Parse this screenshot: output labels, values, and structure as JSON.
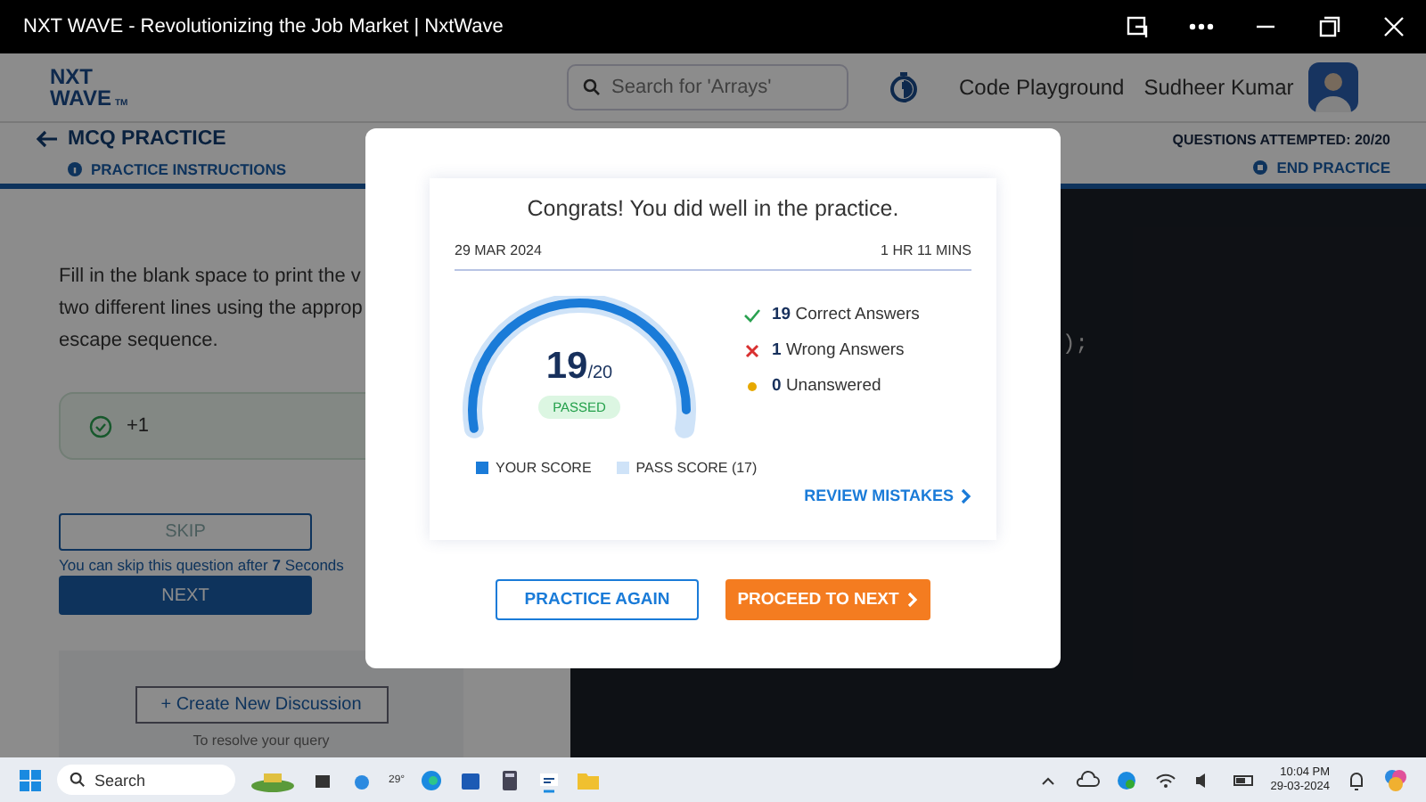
{
  "window": {
    "title": "NXT WAVE - Revolutionizing the Job Market | NxtWave"
  },
  "header": {
    "logo": {
      "line1": "NXT",
      "line2": "WAVE",
      "mark": "TM"
    },
    "search": {
      "placeholder": "Search for 'Arrays'"
    },
    "link": "Code Playground",
    "user": "Sudheer Kumar"
  },
  "subheader": {
    "title": "MCQ PRACTICE",
    "instructions": "PRACTICE INSTRUCTIONS",
    "attempted": "QUESTIONS ATTEMPTED: 20/20",
    "end": "END PRACTICE"
  },
  "question": {
    "lines": [
      "Fill in the blank space to print the v",
      "two different lines using the approp",
      "escape sequence."
    ],
    "result": {
      "score": "+1",
      "correct": true
    },
    "skip": {
      "label": "SKIP",
      "disabled": true
    },
    "skip_note": "You can skip this question after **7** Seconds",
    "next": "NEXT",
    "discussion": {
      "button": "+ Create New Discussion",
      "note": "To resolve your query"
    }
  },
  "editor": {
    "code_fragment": ");"
  },
  "modal": {
    "title": "Congrats! You did well in the practice.",
    "date": "29 MAR 2024",
    "duration": "1 HR 11 MINS",
    "score": {
      "value": "19",
      "total": "/20",
      "level": 0.95,
      "status": "PASSED"
    },
    "legend": [
      {
        "label": "YOUR SCORE",
        "color": "#1a7bd8"
      },
      {
        "label": "PASS SCORE (17)",
        "color": "#cfe3f8"
      }
    ],
    "stats": [
      {
        "kind": "correct",
        "count": "19",
        "label": "Correct Answers"
      },
      {
        "kind": "wrong",
        "count": "1",
        "label": "Wrong Answers"
      },
      {
        "kind": "unanswered",
        "count": "0",
        "label": "Unanswered"
      }
    ],
    "review": "REVIEW MISTAKES",
    "buttons": [
      {
        "label": "PRACTICE AGAIN",
        "kind": "outline"
      },
      {
        "label": "PROCEED TO NEXT",
        "kind": "primary"
      }
    ]
  },
  "taskbar": {
    "search": "Search",
    "weather": "29°",
    "time": "10:04 PM",
    "date": "29-03-2024"
  }
}
